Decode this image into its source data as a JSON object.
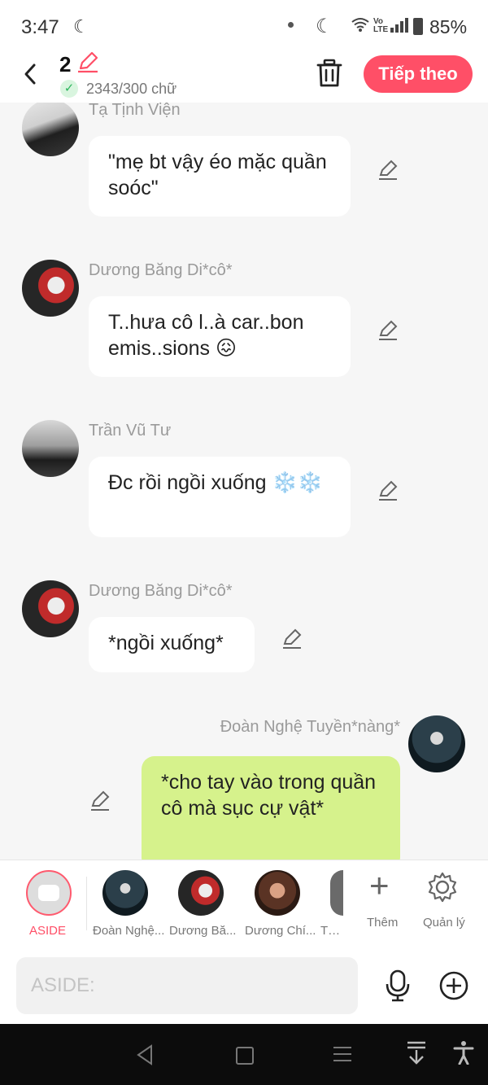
{
  "status_bar": {
    "time": "3:47",
    "battery": "85%"
  },
  "header": {
    "back_icon": "chevron-left-icon",
    "count": "2",
    "word_count": "2343/300 chữ",
    "next_label": "Tiếp theo",
    "accent": "#ff4f67"
  },
  "messages": [
    {
      "name": "Tạ Tịnh Viện",
      "text": "\"mẹ bt vậy éo mặc quần soóc\"",
      "side": "left"
    },
    {
      "name": "Dương Băng Di*cô*",
      "text": "T..hưa cô l..à car..bon emis..sions 😖",
      "side": "left"
    },
    {
      "name": "Trần Vũ Tư",
      "text": "Đc rồi ngồi xuống ❄️❄️",
      "side": "left"
    },
    {
      "name": "Dương Băng Di*cô*",
      "text": "*ngồi xuống*",
      "side": "left"
    },
    {
      "name": "Đoàn Nghệ Tuyền*nàng*",
      "text": "*cho tay vào trong quần cô mà sục cự vật*",
      "side": "right"
    }
  ],
  "character_bar": {
    "aside_label": "ASIDE",
    "characters": [
      "Đoàn Nghệ...",
      "Dương Bă...",
      "Dương Chí...",
      "Tạ T"
    ],
    "add_label": "Thêm",
    "manage_label": "Quản lý"
  },
  "input_bar": {
    "placeholder": "ASIDE:"
  }
}
